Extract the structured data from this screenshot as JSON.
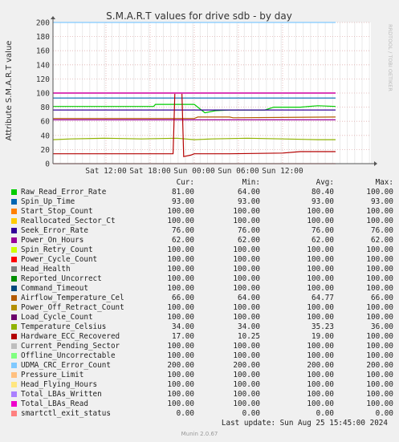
{
  "chart_data": {
    "type": "line",
    "title": "S.M.A.R.T values for drive sdb - by day",
    "ylabel": "Attribute S.M.A.R.T value",
    "watermark": "RRDTOOL / TOBI OETIKER",
    "ylim": [
      0,
      200
    ],
    "yticks": [
      0,
      20,
      40,
      60,
      80,
      100,
      120,
      140,
      160,
      180,
      200
    ],
    "xlim": [
      -0.3,
      1.5
    ],
    "xticks": [
      {
        "pos": 0,
        "label": "Sat 12:00"
      },
      {
        "pos": 0.25,
        "label": "Sat 18:00"
      },
      {
        "pos": 0.5,
        "label": "Sun 00:00"
      },
      {
        "pos": 0.75,
        "label": "Sun 06:00"
      },
      {
        "pos": 1.0,
        "label": "Sun 12:00"
      }
    ],
    "grid": true,
    "series": [
      {
        "name": "Raw_Read_Error_Rate",
        "color": "#00cc00",
        "points": [
          [
            -0.3,
            81
          ],
          [
            0.27,
            81
          ],
          [
            0.28,
            84
          ],
          [
            0.5,
            84
          ],
          [
            0.56,
            72
          ],
          [
            0.62,
            75
          ],
          [
            0.7,
            76
          ],
          [
            0.72,
            76
          ],
          [
            0.9,
            76
          ],
          [
            0.95,
            80
          ],
          [
            1.1,
            80
          ],
          [
            1.2,
            82
          ],
          [
            1.3,
            81
          ]
        ]
      },
      {
        "name": "Spin_Up_Time",
        "color": "#0066b3",
        "points": [
          [
            -0.3,
            93
          ],
          [
            1.3,
            93
          ]
        ]
      },
      {
        "name": "Start_Stop_Count",
        "color": "#ff8000",
        "points": [
          [
            -0.3,
            100
          ],
          [
            1.3,
            100
          ]
        ]
      },
      {
        "name": "Reallocated_Sector_Ct",
        "color": "#ffcc00",
        "points": [
          [
            -0.3,
            100
          ],
          [
            1.3,
            100
          ]
        ]
      },
      {
        "name": "Seek_Error_Rate",
        "color": "#330099",
        "points": [
          [
            -0.3,
            76
          ],
          [
            1.3,
            76
          ]
        ]
      },
      {
        "name": "Power_On_Hours",
        "color": "#990099",
        "points": [
          [
            -0.3,
            62
          ],
          [
            1.3,
            62
          ]
        ]
      },
      {
        "name": "Spin_Retry_Count",
        "color": "#ccff00",
        "points": [
          [
            -0.3,
            100
          ],
          [
            1.3,
            100
          ]
        ]
      },
      {
        "name": "Power_Cycle_Count",
        "color": "#ff0000",
        "points": [
          [
            -0.3,
            100
          ],
          [
            1.3,
            100
          ]
        ]
      },
      {
        "name": "Head_Health",
        "color": "#808080",
        "points": [
          [
            -0.3,
            100
          ],
          [
            1.3,
            100
          ]
        ]
      },
      {
        "name": "Reported_Uncorrect",
        "color": "#008f00",
        "points": [
          [
            -0.3,
            100
          ],
          [
            1.3,
            100
          ]
        ]
      },
      {
        "name": "Command_Timeout",
        "color": "#00487d",
        "points": [
          [
            -0.3,
            100
          ],
          [
            1.3,
            100
          ]
        ]
      },
      {
        "name": "Airflow_Temperature_Cel",
        "color": "#b35a00",
        "points": [
          [
            -0.3,
            64
          ],
          [
            0.5,
            64
          ],
          [
            0.52,
            66
          ],
          [
            0.7,
            66
          ],
          [
            0.72,
            65
          ],
          [
            1.3,
            66
          ]
        ]
      },
      {
        "name": "Power_Off_Retract_Count",
        "color": "#b38f00",
        "points": [
          [
            -0.3,
            100
          ],
          [
            1.3,
            100
          ]
        ]
      },
      {
        "name": "Load_Cycle_Count",
        "color": "#6b006b",
        "points": [
          [
            -0.3,
            100
          ],
          [
            1.3,
            100
          ]
        ]
      },
      {
        "name": "Temperature_Celsius",
        "color": "#8fb300",
        "points": [
          [
            -0.3,
            34
          ],
          [
            -0.2,
            35
          ],
          [
            0.0,
            36
          ],
          [
            0.2,
            35
          ],
          [
            0.4,
            36
          ],
          [
            0.5,
            34
          ],
          [
            0.6,
            35
          ],
          [
            0.8,
            36
          ],
          [
            1.0,
            35
          ],
          [
            1.2,
            34
          ],
          [
            1.3,
            34
          ]
        ]
      },
      {
        "name": "Hardware_ECC_Recovered",
        "color": "#b30000",
        "points": [
          [
            -0.3,
            14
          ],
          [
            0.38,
            14
          ],
          [
            0.39,
            100
          ],
          [
            0.43,
            100
          ],
          [
            0.44,
            10
          ],
          [
            0.48,
            12
          ],
          [
            0.5,
            14
          ],
          [
            0.7,
            14
          ],
          [
            1.0,
            15
          ],
          [
            1.1,
            17
          ],
          [
            1.3,
            17
          ]
        ]
      },
      {
        "name": "Current_Pending_Sector",
        "color": "#bebebe",
        "points": [
          [
            -0.3,
            100
          ],
          [
            1.3,
            100
          ]
        ]
      },
      {
        "name": "Offline_Uncorrectable",
        "color": "#80ff80",
        "points": [
          [
            -0.3,
            100
          ],
          [
            1.3,
            100
          ]
        ]
      },
      {
        "name": "UDMA_CRC_Error_Count",
        "color": "#80c9ff",
        "points": [
          [
            -0.3,
            200
          ],
          [
            1.3,
            200
          ]
        ]
      },
      {
        "name": "Pressure_Limit",
        "color": "#ffc080",
        "points": [
          [
            -0.3,
            100
          ],
          [
            1.3,
            100
          ]
        ]
      },
      {
        "name": "Head_Flying_Hours",
        "color": "#ffe680",
        "points": [
          [
            -0.3,
            100
          ],
          [
            1.3,
            100
          ]
        ]
      },
      {
        "name": "Total_LBAs_Written",
        "color": "#aa80ff",
        "points": [
          [
            -0.3,
            100
          ],
          [
            1.3,
            100
          ]
        ]
      },
      {
        "name": "Total_LBAs_Read",
        "color": "#ee00cc",
        "points": [
          [
            -0.3,
            100
          ],
          [
            1.3,
            100
          ]
        ]
      },
      {
        "name": "smartctl_exit_status",
        "color": "#ff8080",
        "points": [
          [
            -0.3,
            0
          ],
          [
            1.3,
            0
          ]
        ]
      }
    ],
    "threshold_line": {
      "value": 0,
      "color": "#ff0000"
    }
  },
  "legend": {
    "headers": {
      "cur": "Cur:",
      "min": "Min:",
      "avg": "Avg:",
      "max": "Max:"
    },
    "rows": [
      {
        "name": "Raw_Read_Error_Rate",
        "color": "#00cc00",
        "cur": "81.00",
        "min": "64.00",
        "avg": "80.40",
        "max": "100.00"
      },
      {
        "name": "Spin_Up_Time",
        "color": "#0066b3",
        "cur": "93.00",
        "min": "93.00",
        "avg": "93.00",
        "max": "93.00"
      },
      {
        "name": "Start_Stop_Count",
        "color": "#ff8000",
        "cur": "100.00",
        "min": "100.00",
        "avg": "100.00",
        "max": "100.00"
      },
      {
        "name": "Reallocated_Sector_Ct",
        "color": "#ffcc00",
        "cur": "100.00",
        "min": "100.00",
        "avg": "100.00",
        "max": "100.00"
      },
      {
        "name": "Seek_Error_Rate",
        "color": "#330099",
        "cur": "76.00",
        "min": "76.00",
        "avg": "76.00",
        "max": "76.00"
      },
      {
        "name": "Power_On_Hours",
        "color": "#990099",
        "cur": "62.00",
        "min": "62.00",
        "avg": "62.00",
        "max": "62.00"
      },
      {
        "name": "Spin_Retry_Count",
        "color": "#ccff00",
        "cur": "100.00",
        "min": "100.00",
        "avg": "100.00",
        "max": "100.00"
      },
      {
        "name": "Power_Cycle_Count",
        "color": "#ff0000",
        "cur": "100.00",
        "min": "100.00",
        "avg": "100.00",
        "max": "100.00"
      },
      {
        "name": "Head_Health",
        "color": "#808080",
        "cur": "100.00",
        "min": "100.00",
        "avg": "100.00",
        "max": "100.00"
      },
      {
        "name": "Reported_Uncorrect",
        "color": "#008f00",
        "cur": "100.00",
        "min": "100.00",
        "avg": "100.00",
        "max": "100.00"
      },
      {
        "name": "Command_Timeout",
        "color": "#00487d",
        "cur": "100.00",
        "min": "100.00",
        "avg": "100.00",
        "max": "100.00"
      },
      {
        "name": "Airflow_Temperature_Cel",
        "color": "#b35a00",
        "cur": "66.00",
        "min": "64.00",
        "avg": "64.77",
        "max": "66.00"
      },
      {
        "name": "Power_Off_Retract_Count",
        "color": "#b38f00",
        "cur": "100.00",
        "min": "100.00",
        "avg": "100.00",
        "max": "100.00"
      },
      {
        "name": "Load_Cycle_Count",
        "color": "#6b006b",
        "cur": "100.00",
        "min": "100.00",
        "avg": "100.00",
        "max": "100.00"
      },
      {
        "name": "Temperature_Celsius",
        "color": "#8fb300",
        "cur": "34.00",
        "min": "34.00",
        "avg": "35.23",
        "max": "36.00"
      },
      {
        "name": "Hardware_ECC_Recovered",
        "color": "#b30000",
        "cur": "17.00",
        "min": "10.25",
        "avg": "19.00",
        "max": "100.00"
      },
      {
        "name": "Current_Pending_Sector",
        "color": "#bebebe",
        "cur": "100.00",
        "min": "100.00",
        "avg": "100.00",
        "max": "100.00"
      },
      {
        "name": "Offline_Uncorrectable",
        "color": "#80ff80",
        "cur": "100.00",
        "min": "100.00",
        "avg": "100.00",
        "max": "100.00"
      },
      {
        "name": "UDMA_CRC_Error_Count",
        "color": "#80c9ff",
        "cur": "200.00",
        "min": "200.00",
        "avg": "200.00",
        "max": "200.00"
      },
      {
        "name": "Pressure_Limit",
        "color": "#ffc080",
        "cur": "100.00",
        "min": "100.00",
        "avg": "100.00",
        "max": "100.00"
      },
      {
        "name": "Head_Flying_Hours",
        "color": "#ffe680",
        "cur": "100.00",
        "min": "100.00",
        "avg": "100.00",
        "max": "100.00"
      },
      {
        "name": "Total_LBAs_Written",
        "color": "#aa80ff",
        "cur": "100.00",
        "min": "100.00",
        "avg": "100.00",
        "max": "100.00"
      },
      {
        "name": "Total_LBAs_Read",
        "color": "#ee00cc",
        "cur": "100.00",
        "min": "100.00",
        "avg": "100.00",
        "max": "100.00"
      },
      {
        "name": "smartctl_exit_status",
        "color": "#ff8080",
        "cur": "0.00",
        "min": "0.00",
        "avg": "0.00",
        "max": "0.00"
      }
    ]
  },
  "last_update": "Last update:  Sun Aug 25 15:45:00 2024",
  "footer": "Munin 2.0.67"
}
